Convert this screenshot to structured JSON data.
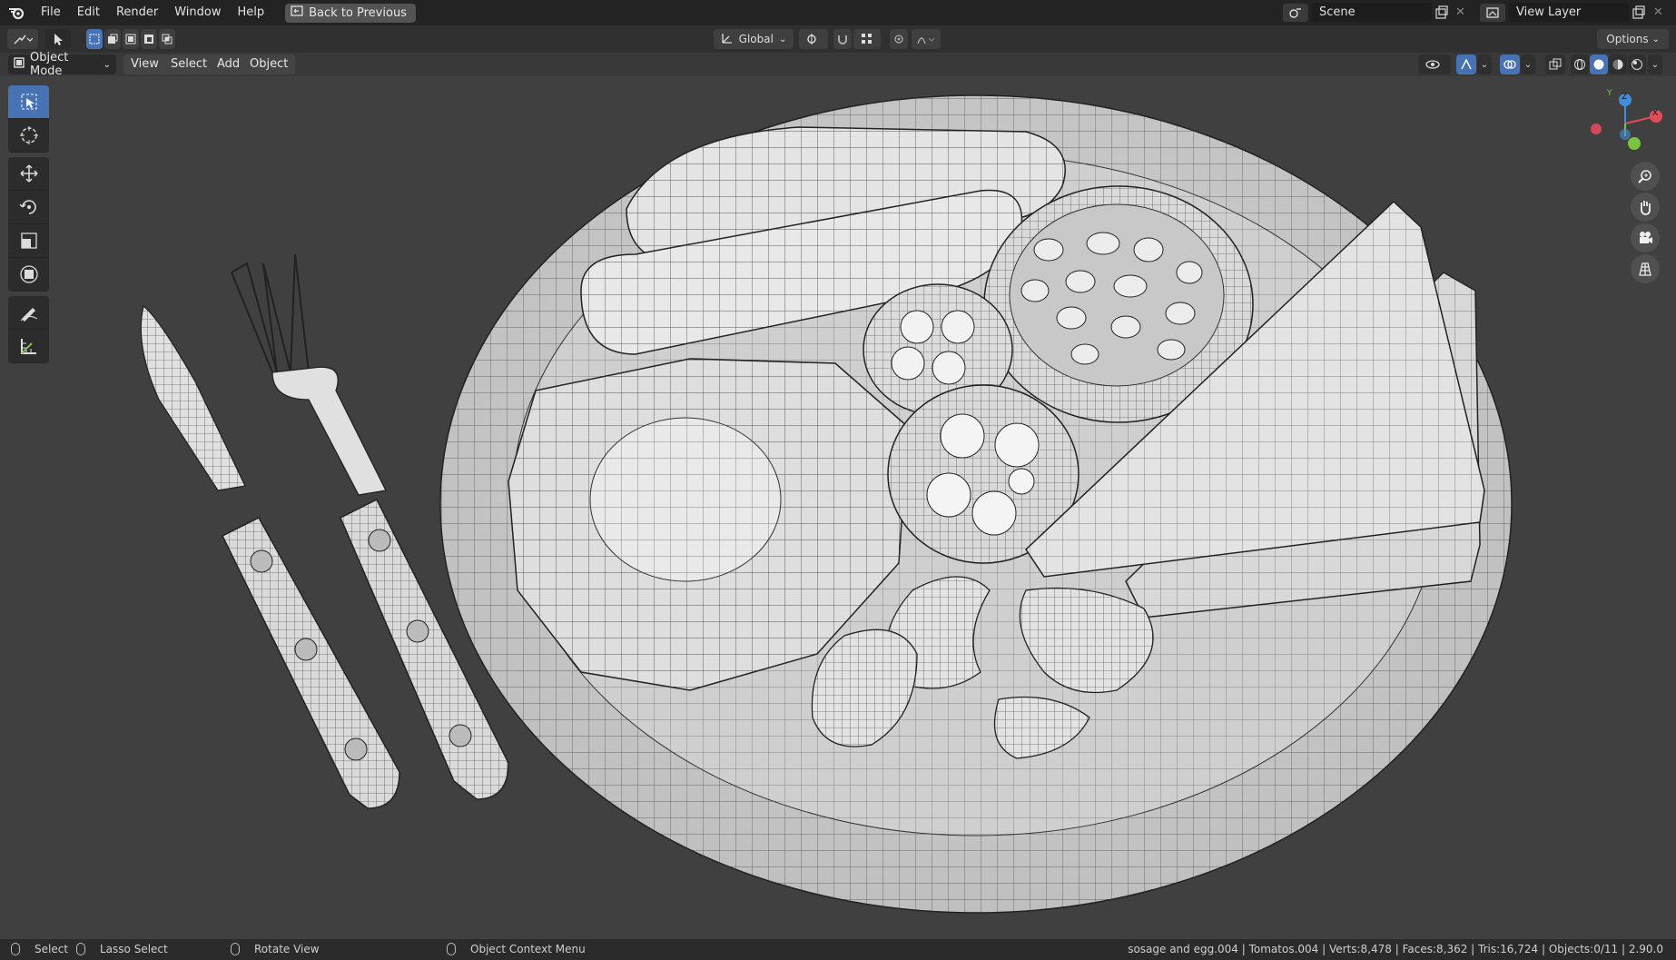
{
  "menubar": {
    "items": [
      "File",
      "Edit",
      "Render",
      "Window",
      "Help"
    ],
    "back_button": "Back to Previous",
    "scene_label": "Scene",
    "view_layer_label": "View Layer"
  },
  "header": {
    "transform_orientation": "Global",
    "options_label": "Options"
  },
  "viewport_header": {
    "mode": "Object Mode",
    "menus": [
      "View",
      "Select",
      "Add",
      "Object"
    ]
  },
  "gizmo": {
    "z": "Z",
    "y": "Y",
    "x": "X"
  },
  "statusbar": {
    "select": "Select",
    "lasso": "Lasso Select",
    "rotate": "Rotate View",
    "context": "Object Context Menu",
    "stats": "sosage and egg.004 | Tomatos.004 | Verts:8,478 | Faces:8,362 | Tris:16,724 | Objects:0/11 | 2.90.0"
  },
  "colors": {
    "accent": "#4772b3",
    "axis_x": "#e34a5a",
    "axis_y": "#7bc443",
    "axis_z": "#3f8fdc"
  }
}
